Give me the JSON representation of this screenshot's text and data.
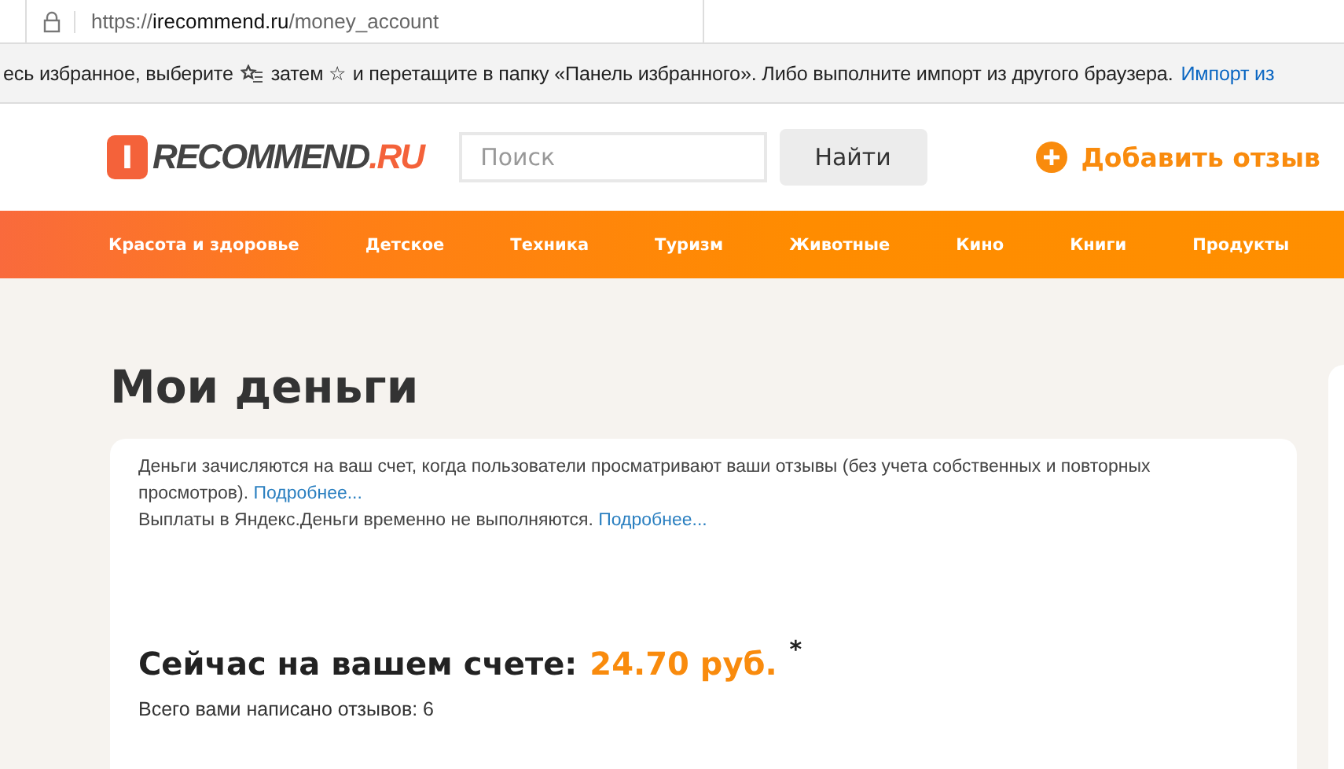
{
  "address_bar": {
    "scheme": "https://",
    "host": "irecommend.ru",
    "path": "/money_account"
  },
  "favorites_bar": {
    "hint_before": "есь избранное, выберите",
    "hint_after": "затем ☆ и перетащите в папку «Панель избранного». Либо выполните импорт из другого браузера.",
    "link": "Импорт из"
  },
  "header": {
    "logo": {
      "mark": "I",
      "name": "RECOMMEND",
      "suffix": ".RU"
    },
    "search": {
      "placeholder": "Поиск"
    },
    "search_button": "Найти",
    "add_review": "Добавить отзыв"
  },
  "nav": [
    "Красота и здоровье",
    "Детское",
    "Техника",
    "Туризм",
    "Животные",
    "Кино",
    "Книги",
    "Продукты"
  ],
  "page_title": "Мои деньги",
  "info": {
    "line_1": "Деньги зачисляются на ваш счет, когда пользователи просматривают ваши отзывы (без учета собственных и повторных просмотров).",
    "link_1": "Подробнее...",
    "line_2": "Выплаты в Яндекс.Деньги временно не выполняются.",
    "link_2": "Подробнее..."
  },
  "balance": {
    "label": "Сейчас на вашем счете:",
    "amount": "24.70 руб.",
    "mark": "*",
    "reviews": "Всего вами написано отзывов: 6"
  }
}
